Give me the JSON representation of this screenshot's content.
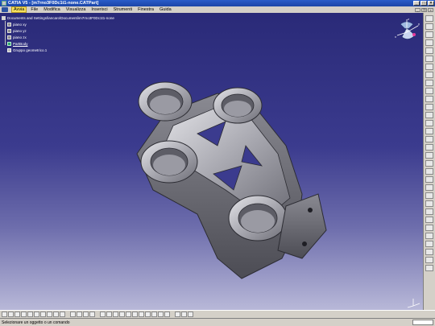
{
  "window": {
    "title": "CATIA V5 - [m7rno3F0Dc1t1-none.CATPart]"
  },
  "menubar": {
    "items": [
      "Avvia",
      "File",
      "Modifica",
      "Visualizza",
      "Inserisci",
      "Strumenti",
      "Finestra",
      "Guida"
    ],
    "active_index": 0
  },
  "tree": {
    "root": "Documents and Settings\\lancaro\\Documenti\\m7rno3F0Dc1t1-none",
    "children": [
      {
        "label": "piano xy",
        "icon": "plane-icon"
      },
      {
        "label": "piano yz",
        "icon": "plane-icon"
      },
      {
        "label": "piano zx",
        "icon": "plane-icon"
      },
      {
        "label": "PartBody",
        "icon": "partbody-icon"
      },
      {
        "label": "Gruppo geometrico.1",
        "icon": "geometric-set-icon"
      }
    ]
  },
  "status": {
    "message": "Selezionare un oggetto o un comando"
  },
  "colors": {
    "titlebar": "#1b45a8",
    "viewport_top": "#2a2a78",
    "viewport_bottom": "#b8b8d8",
    "menu_active": "#f6e05e"
  }
}
